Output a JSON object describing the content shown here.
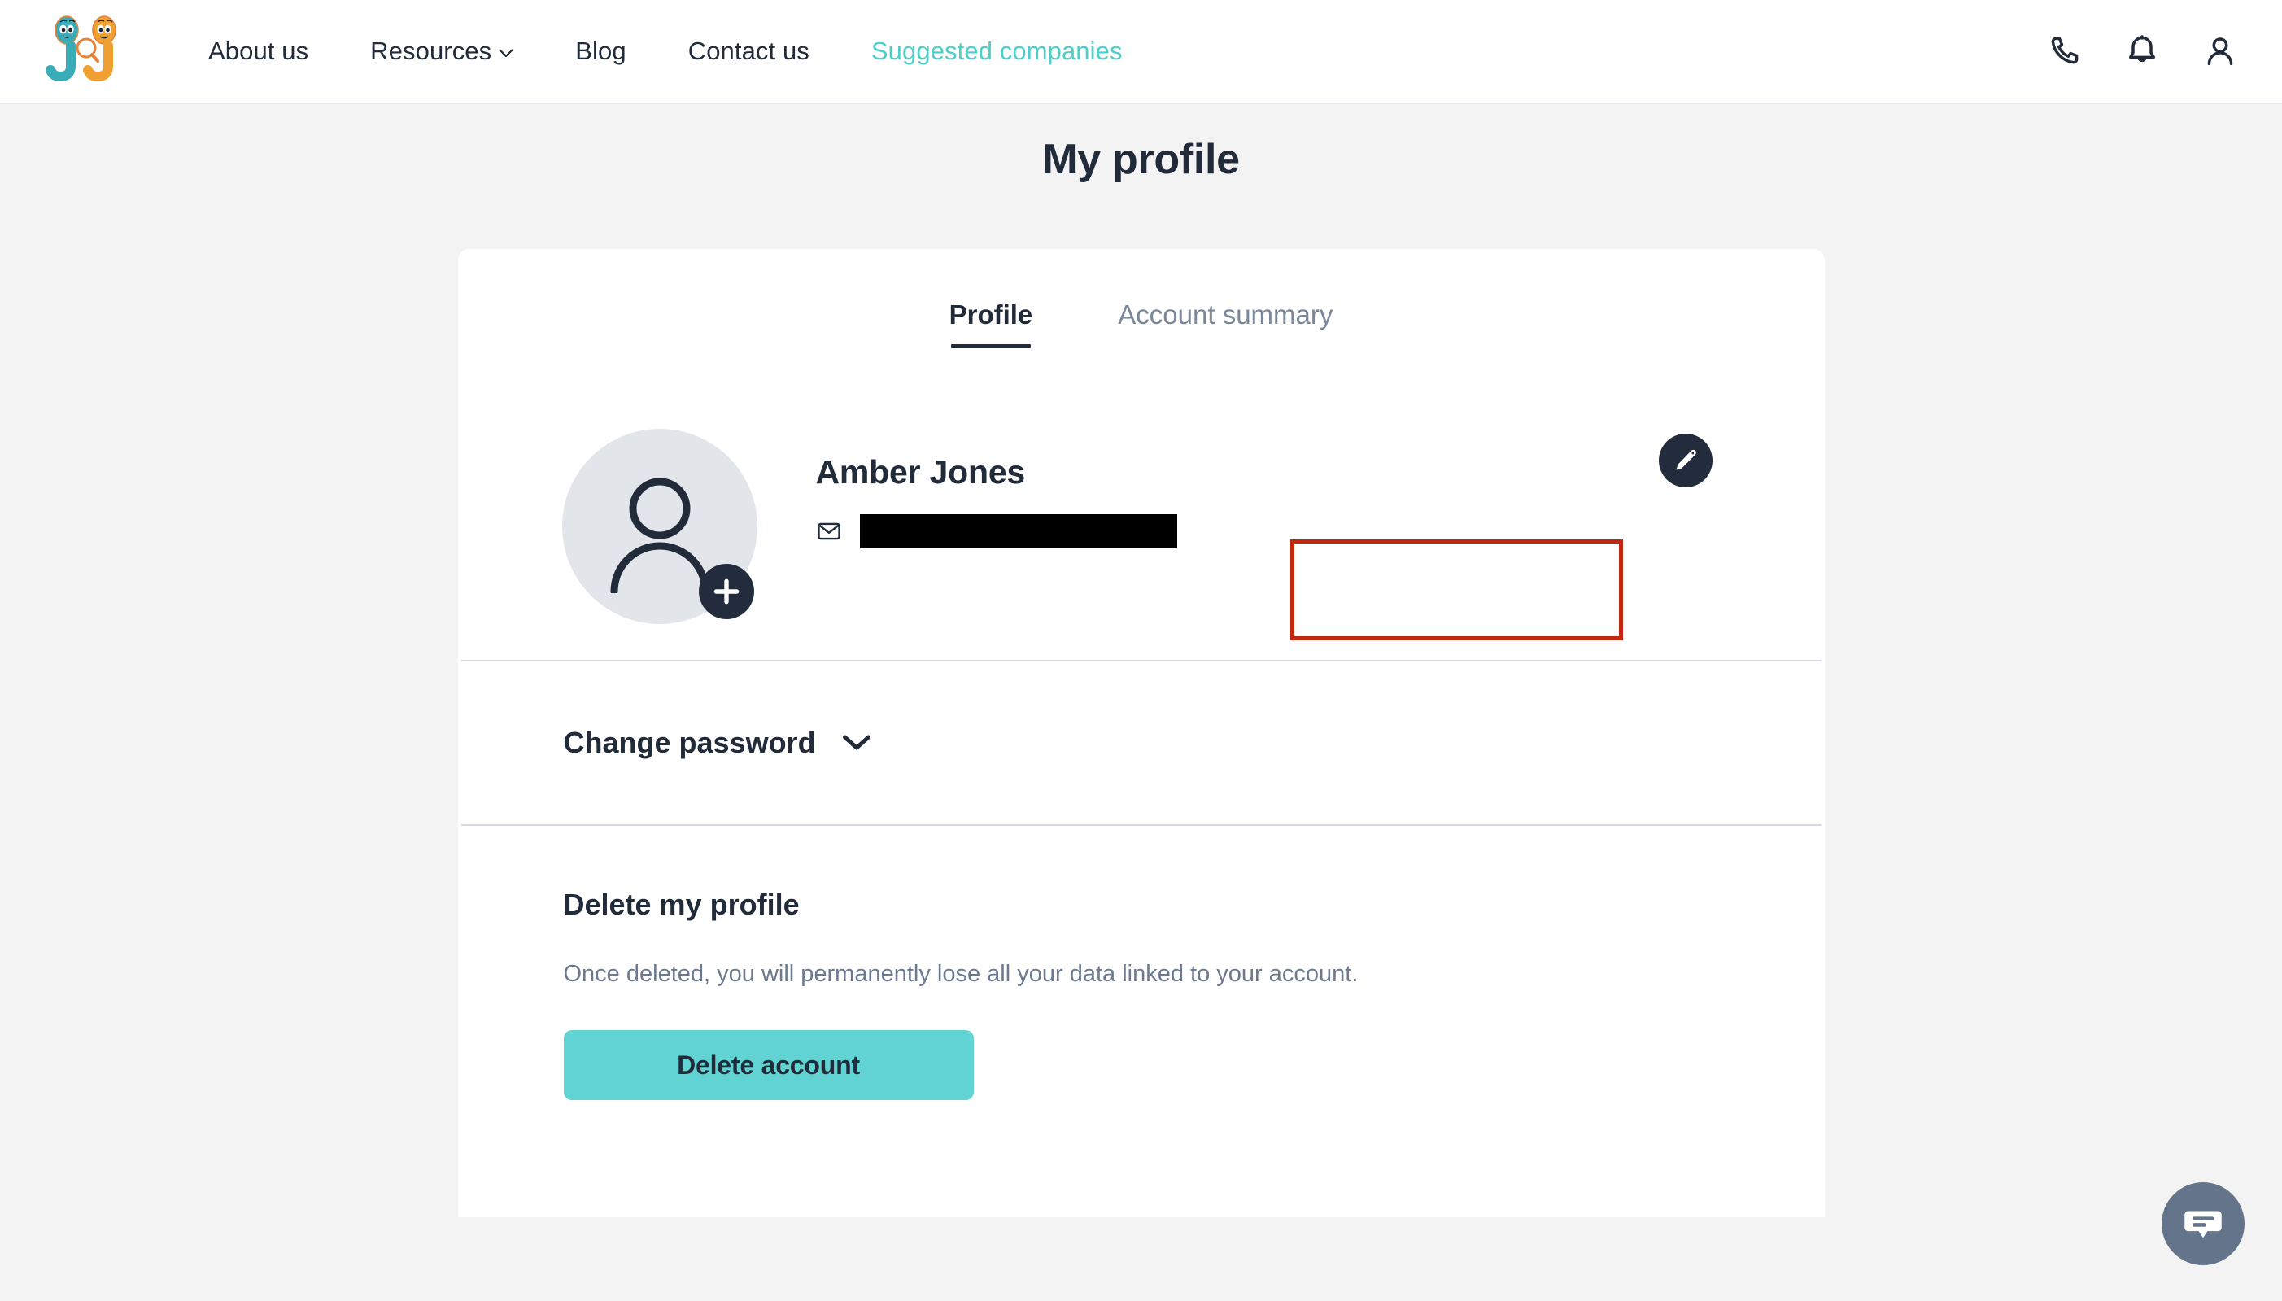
{
  "header": {
    "logo_alt": "Jungle Jobs logo",
    "nav": [
      {
        "label": "About us",
        "accent": false,
        "has_caret": false
      },
      {
        "label": "Resources",
        "accent": false,
        "has_caret": true
      },
      {
        "label": "Blog",
        "accent": false,
        "has_caret": false
      },
      {
        "label": "Contact us",
        "accent": false,
        "has_caret": false
      },
      {
        "label": "Suggested companies",
        "accent": true,
        "has_caret": false
      }
    ],
    "actions": [
      {
        "icon": "phone-icon"
      },
      {
        "icon": "bell-icon"
      },
      {
        "icon": "user-icon"
      }
    ]
  },
  "page": {
    "title": "My profile"
  },
  "tabs": {
    "items": [
      {
        "label": "Profile",
        "active": true
      },
      {
        "label": "Account summary",
        "active": false
      }
    ]
  },
  "profile": {
    "name": "Amber Jones",
    "email_value": "",
    "email_redacted": true,
    "avatar_add_label": "+",
    "edit_label": "Edit profile"
  },
  "change_password": {
    "label": "Change password",
    "expanded": false
  },
  "delete": {
    "heading": "Delete my profile",
    "note": "Once deleted, you will permanently lose all your data linked to your account.",
    "button_label": "Delete account"
  },
  "chat": {
    "label": "Open chat"
  },
  "colors": {
    "accent_teal": "#4ecdc9",
    "button_teal": "#61d3d3",
    "dark_navy": "#212b3a",
    "muted_gray": "#7a8699",
    "page_bg": "#f3f3f4",
    "annotation_red": "#c0280f",
    "chat_slate": "#64748b"
  }
}
